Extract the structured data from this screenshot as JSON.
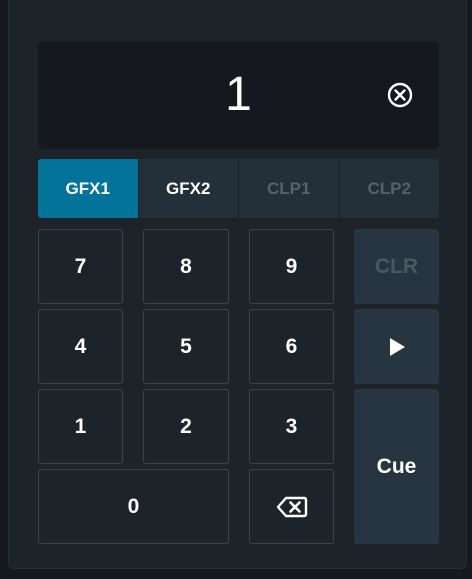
{
  "display": {
    "value": "1",
    "clear_icon": "circle-x-icon"
  },
  "tabs": [
    {
      "label": "GFX1",
      "state": "active"
    },
    {
      "label": "GFX2",
      "state": "normal"
    },
    {
      "label": "CLP1",
      "state": "disabled"
    },
    {
      "label": "CLP2",
      "state": "disabled"
    }
  ],
  "keypad": {
    "k7": "7",
    "k8": "8",
    "k9": "9",
    "k4": "4",
    "k5": "5",
    "k6": "6",
    "k1": "1",
    "k2": "2",
    "k3": "3",
    "k0": "0",
    "backspace_icon": "backspace-icon"
  },
  "side": {
    "clr": "CLR",
    "play_icon": "play-icon",
    "cue": "Cue"
  },
  "colors": {
    "accent": "#03739a",
    "background": "#1d2329",
    "display_bg": "#15191d",
    "side_button": "#263540",
    "disabled_text": "#4c5860"
  }
}
